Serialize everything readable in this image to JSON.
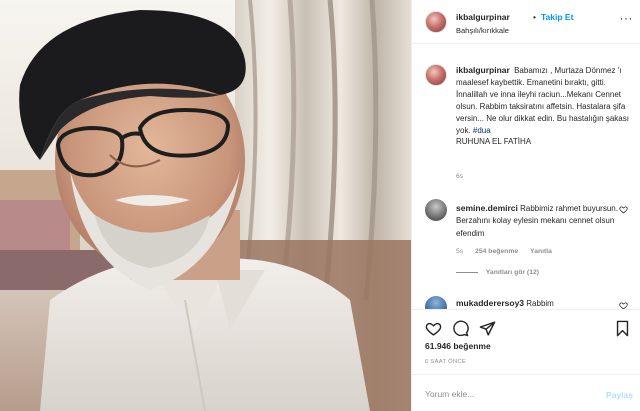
{
  "post": {
    "username": "ikbalgurpinar",
    "follow_separator": "•",
    "follow_label": "Takip Et",
    "location": "Bahşılı/kırıkkale",
    "more_icon": "more-horizontal-icon"
  },
  "caption": {
    "username": "ikbalgurpinar",
    "text": "Babamızı , Murtaza Dönmez 'ı maalesef kaybettik. Emanetini bıraktı, gitti. İnnalillah ve inna ileyhi raciun...Mekanı Cennet olsun. Rabbim taksiratını affetsin. Hastalara şifa versin... Ne olur dikkat edin. Bu hastalığın şakası yok.",
    "hashtag": "#dua",
    "closing": "RUHUNA EL FATİHA",
    "time": "6s"
  },
  "comments": [
    {
      "username": "semine.demirci",
      "text": "Rabbimiz rahmet buyursun. Berzahını kolay eylesin mekanı cennet olsun efendim",
      "time": "5s",
      "likes": "254 beğenme",
      "reply": "Yanıtla",
      "view_replies": "Yanıtları gör (12)"
    },
    {
      "username": "mukadderersoy3",
      "text": "Rabbim"
    }
  ],
  "actions": {
    "likes": "61.946 beğenme",
    "time_ago": "6 SAAT ÖNCE"
  },
  "add_comment": {
    "placeholder": "Yorum ekle...",
    "post_label": "Paylaş"
  },
  "colors": {
    "accent": "#0095f6",
    "secondary_text": "#8e8e8e",
    "border": "#efefef"
  }
}
